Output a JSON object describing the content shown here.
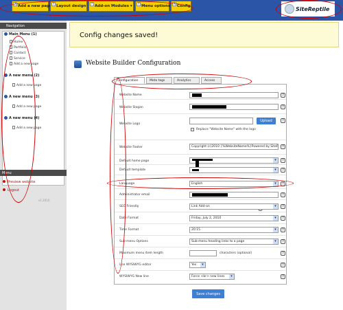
{
  "toolbar": {
    "add_page": "Add a new page",
    "layout": "Layout design",
    "addon_modules": "Add-on Modules",
    "menu_options": "Menu options",
    "config": "Config",
    "help_glyph": "?"
  },
  "logo": {
    "text": "SiteReptile"
  },
  "sidebar": {
    "navigation_title": "Navigation",
    "menus": [
      {
        "title": "Main Menu (1)",
        "items": [
          "Home",
          "Portfolio",
          "Contact",
          "Service"
        ],
        "add": "Add a new page"
      },
      {
        "title": "A new menu (2)",
        "add": "Add a new page"
      },
      {
        "title": "A new menu (3)",
        "add": "Add a new page"
      },
      {
        "title": "A new menu (4)",
        "add": "Add a new page"
      }
    ],
    "menu_title": "Menu",
    "preview": "Preview website",
    "logout": "Logout",
    "version": "v1.2010"
  },
  "banner": {
    "message": "Config changes saved!"
  },
  "config": {
    "title": "Website Builder Configuration",
    "tabs": [
      "Configuration",
      "Meta tags",
      "Analytics",
      "Access"
    ],
    "fields": {
      "website_name": "Website Name",
      "website_slogan": "Website Slogan",
      "website_logo": "Website Logo",
      "upload": "Upload",
      "replace_label": "Replace \"Website Name\" with the logo",
      "website_footer": "Website Footer",
      "footer_value": "Copyright (c)2010 {%WebsiteName%}Powered by SiteReptile",
      "default_home_page": "Default home page",
      "default_template": "Default template",
      "language": "Language",
      "language_value": "English",
      "admin_email": "Administrator email",
      "seo_friendly": "SEO Friendly",
      "seo_value": "Link Add-on",
      "date_format": "Date Format",
      "date_value": "Friday, July 2, 2010",
      "time_format": "Time Format",
      "time_value": "20:15",
      "submenu_options": "Sub-menu Options",
      "submenu_value": "Sub-menu heading links to a page",
      "max_menu_length": "Maximum menu item length",
      "characters_optional": "characters (optional)",
      "use_wysiwyg": "Use WYSIWYG editor",
      "wysiwyg_value": "Yes",
      "wysiwyg_newline": "WYSIWYG New line",
      "newline_value": "Force <br> new lines"
    },
    "save": "Save changes"
  },
  "colors": {
    "accent": "#2b56a8",
    "toolbar": "#f5d000",
    "annotation": "#d00000",
    "button": "#3d7fd4"
  }
}
